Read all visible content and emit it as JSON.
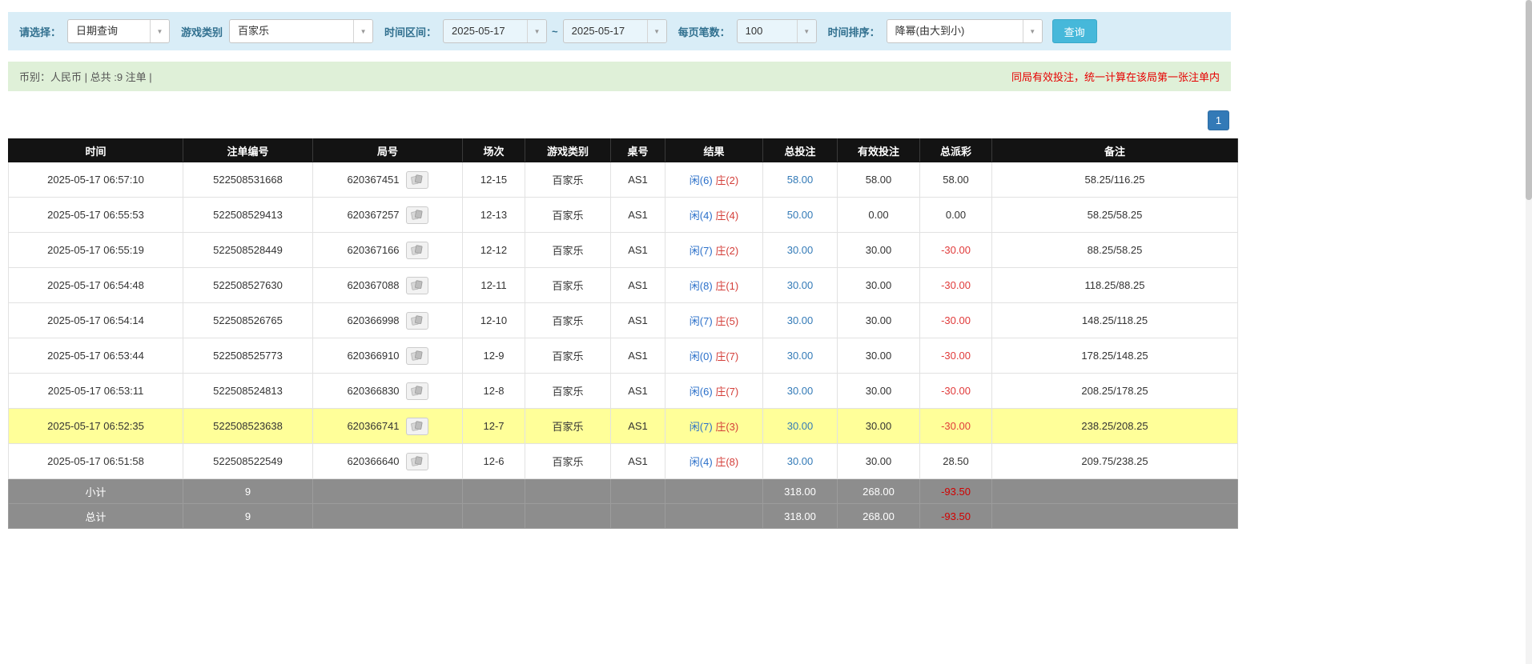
{
  "filters": {
    "select_label": "请选择：",
    "select_value": "日期查询",
    "game_label": "游戏类别",
    "game_value": "百家乐",
    "range_label": "时间区间：",
    "date_from": "2025-05-17",
    "range_separator": "~",
    "date_to": "2025-05-17",
    "page_size_label": "每页笔数：",
    "page_size_value": "100",
    "sort_label": "时间排序：",
    "sort_value": "降幂(由大到小)",
    "query_button": "查询"
  },
  "info_bar": {
    "summary": "币别：人民币 | 总共 :9 注单 |",
    "notice": "同局有效投注，统一计算在该局第一张注单内"
  },
  "pagination": {
    "current_page": "1"
  },
  "table": {
    "headers": [
      "时间",
      "注单编号",
      "局号",
      "场次",
      "游戏类别",
      "桌号",
      "结果",
      "总投注",
      "有效投注",
      "总派彩",
      "备注"
    ],
    "rows": [
      {
        "time": "2025-05-17 06:57:10",
        "bet_id": "522508531668",
        "round_no": "620367451",
        "session": "12-15",
        "game": "百家乐",
        "table_no": "AS1",
        "result_player": "闲(6)",
        "result_banker": "庄(2)",
        "total_bet": "58.00",
        "valid_bet": "58.00",
        "payout": "58.00",
        "note": "58.25/116.25",
        "highlighted": false
      },
      {
        "time": "2025-05-17 06:55:53",
        "bet_id": "522508529413",
        "round_no": "620367257",
        "session": "12-13",
        "game": "百家乐",
        "table_no": "AS1",
        "result_player": "闲(4)",
        "result_banker": "庄(4)",
        "total_bet": "50.00",
        "valid_bet": "0.00",
        "payout": "0.00",
        "note": "58.25/58.25",
        "highlighted": false
      },
      {
        "time": "2025-05-17 06:55:19",
        "bet_id": "522508528449",
        "round_no": "620367166",
        "session": "12-12",
        "game": "百家乐",
        "table_no": "AS1",
        "result_player": "闲(7)",
        "result_banker": "庄(2)",
        "total_bet": "30.00",
        "valid_bet": "30.00",
        "payout": "-30.00",
        "note": "88.25/58.25",
        "highlighted": false
      },
      {
        "time": "2025-05-17 06:54:48",
        "bet_id": "522508527630",
        "round_no": "620367088",
        "session": "12-11",
        "game": "百家乐",
        "table_no": "AS1",
        "result_player": "闲(8)",
        "result_banker": "庄(1)",
        "total_bet": "30.00",
        "valid_bet": "30.00",
        "payout": "-30.00",
        "note": "118.25/88.25",
        "highlighted": false
      },
      {
        "time": "2025-05-17 06:54:14",
        "bet_id": "522508526765",
        "round_no": "620366998",
        "session": "12-10",
        "game": "百家乐",
        "table_no": "AS1",
        "result_player": "闲(7)",
        "result_banker": "庄(5)",
        "total_bet": "30.00",
        "valid_bet": "30.00",
        "payout": "-30.00",
        "note": "148.25/118.25",
        "highlighted": false
      },
      {
        "time": "2025-05-17 06:53:44",
        "bet_id": "522508525773",
        "round_no": "620366910",
        "session": "12-9",
        "game": "百家乐",
        "table_no": "AS1",
        "result_player": "闲(0)",
        "result_banker": "庄(7)",
        "total_bet": "30.00",
        "valid_bet": "30.00",
        "payout": "-30.00",
        "note": "178.25/148.25",
        "highlighted": false
      },
      {
        "time": "2025-05-17 06:53:11",
        "bet_id": "522508524813",
        "round_no": "620366830",
        "session": "12-8",
        "game": "百家乐",
        "table_no": "AS1",
        "result_player": "闲(6)",
        "result_banker": "庄(7)",
        "total_bet": "30.00",
        "valid_bet": "30.00",
        "payout": "-30.00",
        "note": "208.25/178.25",
        "highlighted": false
      },
      {
        "time": "2025-05-17 06:52:35",
        "bet_id": "522508523638",
        "round_no": "620366741",
        "session": "12-7",
        "game": "百家乐",
        "table_no": "AS1",
        "result_player": "闲(7)",
        "result_banker": "庄(3)",
        "total_bet": "30.00",
        "valid_bet": "30.00",
        "payout": "-30.00",
        "note": "238.25/208.25",
        "highlighted": true
      },
      {
        "time": "2025-05-17 06:51:58",
        "bet_id": "522508522549",
        "round_no": "620366640",
        "session": "12-6",
        "game": "百家乐",
        "table_no": "AS1",
        "result_player": "闲(4)",
        "result_banker": "庄(8)",
        "total_bet": "30.00",
        "valid_bet": "30.00",
        "payout": "28.50",
        "note": "209.75/238.25",
        "highlighted": false
      }
    ],
    "footer": [
      {
        "label": "小计",
        "count": "9",
        "total_bet": "318.00",
        "valid_bet": "268.00",
        "payout": "-93.50"
      },
      {
        "label": "总计",
        "count": "9",
        "total_bet": "318.00",
        "valid_bet": "268.00",
        "payout": "-93.50"
      }
    ]
  },
  "colors": {
    "filter_bar_bg": "#d9edf7",
    "info_bar_bg": "#dff0d8",
    "accent_blue": "#337ab7",
    "query_button_teal": "#46b8da",
    "player_blue": "#2a6fc9",
    "banker_red": "#d43f3a",
    "negative_red": "#e03a3a",
    "notice_red": "#e60000",
    "highlight_yellow": "#ffff99",
    "header_black": "#131313",
    "footer_gray": "#8d8d8d"
  }
}
